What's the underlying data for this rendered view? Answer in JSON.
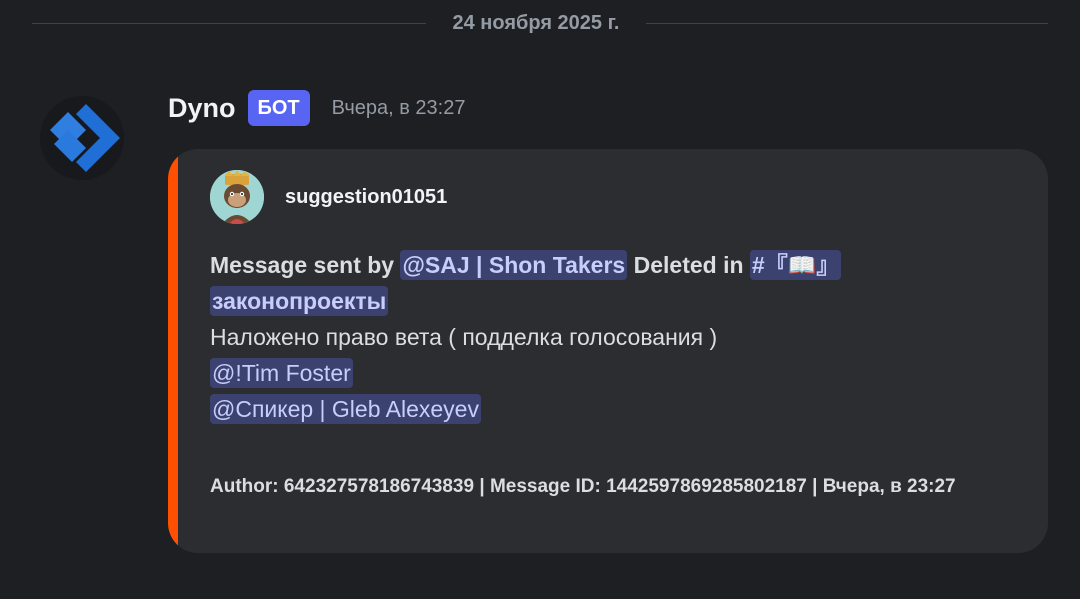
{
  "date_divider": "24 ноября 2025 г.",
  "message": {
    "author": "Dyno",
    "bot_tag": "БОТ",
    "timestamp": "Вчера, в 23:27"
  },
  "embed": {
    "accent_color": "#ff4f00",
    "author_name": "suggestion01051",
    "description": {
      "prefix": "Message sent by",
      "user_mention": "@SAJ | Shon Takers",
      "deleted_in": "Deleted in",
      "channel_mention_hash": "#『📖』",
      "channel_mention_name": "законопроекты",
      "body": "Наложено право вета ( подделка голосования )",
      "mention_1": "@!Tim Foster",
      "mention_2": "@Спикер | Gleb Alexeyev"
    },
    "footer": "Author: 642327578186743839 | Message ID: 1442597869285802187 | Вчера, в 23:27"
  },
  "colors": {
    "background": "#1e1f22",
    "embed_background": "#2b2d31",
    "bot_badge": "#5865f2",
    "mention_bg": "#3c4270"
  },
  "icons": {
    "bot_avatar": "dyno-chevron-logo",
    "author_avatar": "ape-avatar"
  }
}
